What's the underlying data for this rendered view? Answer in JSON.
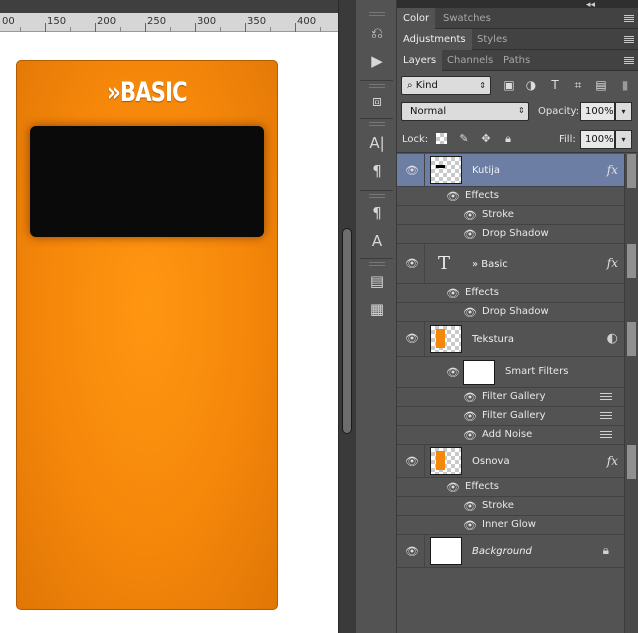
{
  "ruler": {
    "labels": [
      "00",
      "150",
      "200",
      "250",
      "300",
      "350",
      "400"
    ]
  },
  "canvas": {
    "card": {
      "title": "»BASIC",
      "color": "#f5870a"
    }
  },
  "tools": {
    "history_icon": "history-brush-icon",
    "play_icon": "play-action-icon",
    "cube_icon": "3d-cube-icon",
    "char_icon": "character-icon",
    "para_icon": "paragraph-icon",
    "char_styles_icon": "character-styles-icon",
    "para_styles_icon": "paragraph-styles-icon",
    "notes_icon": "notes-icon",
    "properties_icon": "properties-icon"
  },
  "panels": {
    "group1": {
      "tabs": [
        "Color",
        "Swatches"
      ],
      "active": "Color"
    },
    "group2": {
      "tabs": [
        "Adjustments",
        "Styles"
      ],
      "active": "Adjustments"
    },
    "group3": {
      "tabs": [
        "Layers",
        "Channels",
        "Paths"
      ],
      "active": "Layers"
    },
    "filter": {
      "kind": "Kind"
    },
    "blend_mode": "Normal",
    "opacity_label": "Opacity:",
    "opacity": "100%",
    "lock_label": "Lock:",
    "fill_label": "Fill:",
    "fill": "100%"
  },
  "layers": [
    {
      "name": "Kutija",
      "type": "shape",
      "selected": true,
      "fx": "fx",
      "effects_label": "Effects",
      "effects": [
        "Stroke",
        "Drop Shadow"
      ]
    },
    {
      "name": "» Basic",
      "type": "text",
      "selected": false,
      "fx": "fx",
      "effects_label": "Effects",
      "effects": [
        "Drop Shadow"
      ]
    },
    {
      "name": "Tekstura",
      "type": "smart",
      "selected": false,
      "smart_filters_label": "Smart Filters",
      "filters": [
        "Filter Gallery",
        "Filter Gallery",
        "Add Noise"
      ]
    },
    {
      "name": "Osnova",
      "type": "shape",
      "selected": false,
      "fx": "fx",
      "effects_label": "Effects",
      "effects": [
        "Stroke",
        "Inner Glow"
      ]
    },
    {
      "name": "Background",
      "type": "background",
      "selected": false,
      "locked": true
    }
  ],
  "colors": {
    "selected_row": "#6c7ea3",
    "accent_orange": "#f5870a",
    "panel_bg": "#535353"
  }
}
